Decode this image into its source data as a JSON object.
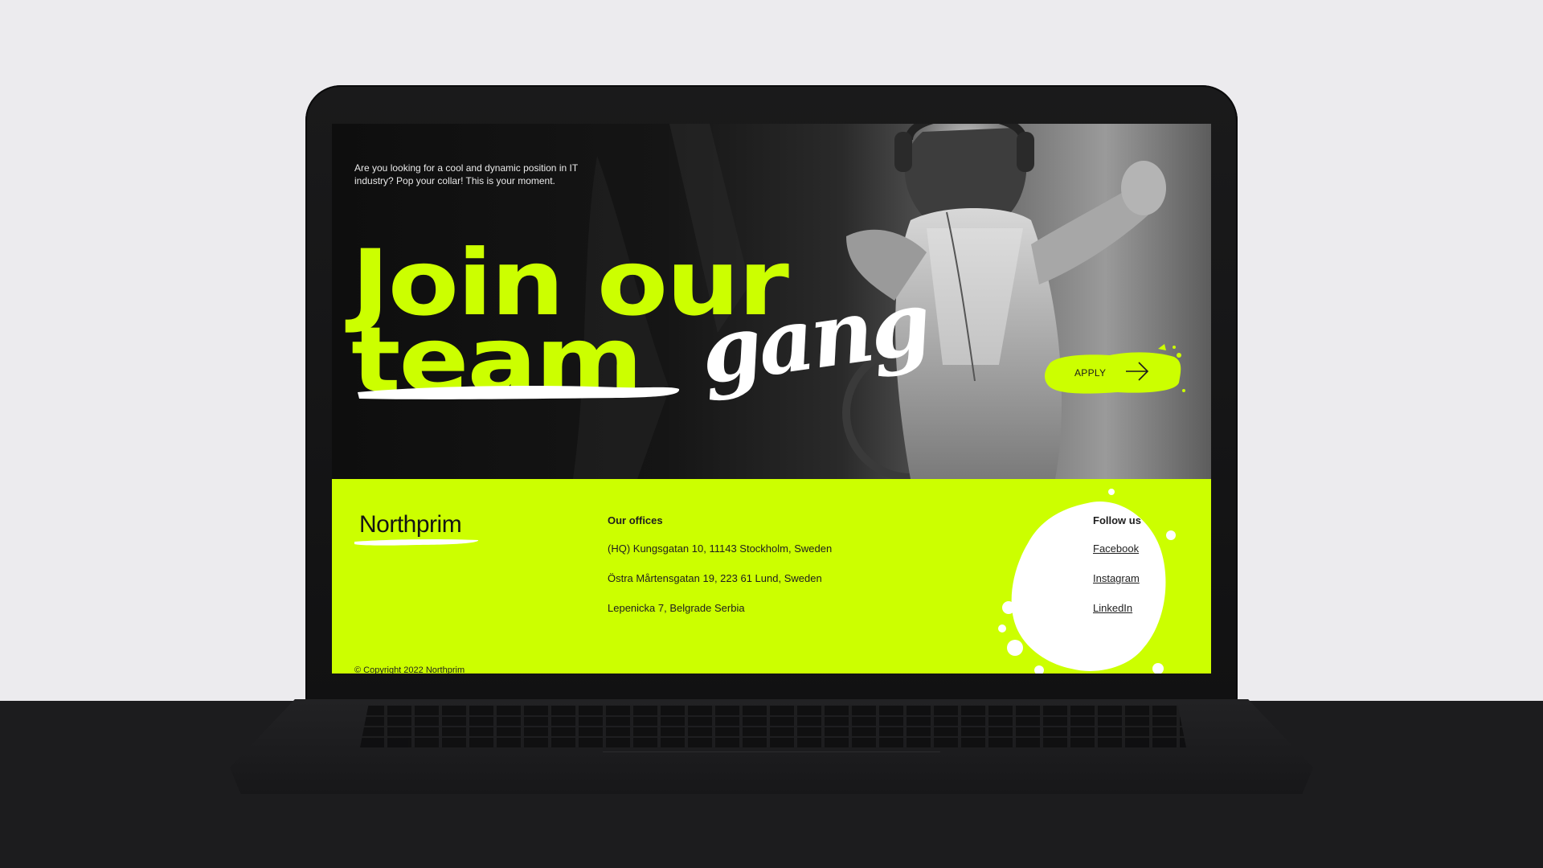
{
  "hero": {
    "intro": "Are you looking for a cool and dynamic position in IT industry? Pop your collar! This is your moment.",
    "headline": "Join our",
    "struck_word": "team",
    "script_word": "gang",
    "apply_label": "APPLY",
    "accent_color": "#ccff00"
  },
  "brand": {
    "logo": "Northprim"
  },
  "offices": {
    "title": "Our offices",
    "items": [
      "(HQ) Kungsgatan 10, 11143 Stockholm, Sweden",
      "Östra Mårtensgatan 19, 223 61 Lund, Sweden",
      "Lepenicka 7, Belgrade Serbia"
    ]
  },
  "follow": {
    "title": "Follow us",
    "links": [
      "Facebook",
      "Instagram",
      "LinkedIn"
    ]
  },
  "footer": {
    "copyright": "© Copyright 2022 Northprim"
  },
  "icons": {
    "apply": "arrow-right-icon"
  }
}
